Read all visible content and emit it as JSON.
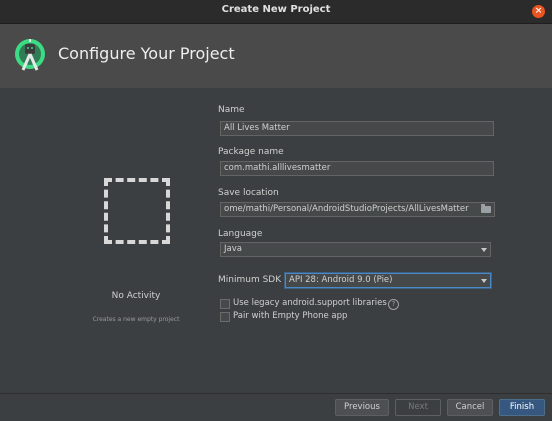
{
  "window": {
    "title": "Create New Project"
  },
  "header": {
    "heading": "Configure Your Project",
    "logo_icon": "android-studio-logo-icon"
  },
  "activity": {
    "name": "No Activity",
    "description": "Creates a new empty project"
  },
  "form": {
    "name": {
      "label": "Name",
      "value": "All Lives Matter"
    },
    "package": {
      "label": "Package name",
      "value": "com.mathi.alllivesmatter"
    },
    "save_location": {
      "label": "Save location",
      "value": "ome/mathi/Personal/AndroidStudioProjects/AllLivesMatter"
    },
    "language": {
      "label": "Language",
      "value": "Java"
    },
    "min_sdk": {
      "label": "Minimum SDK",
      "value": "API 28: Android 9.0 (Pie)"
    },
    "legacy_support": {
      "label": "Use legacy android.support libraries",
      "checked": false
    },
    "phone_app": {
      "label": "Pair with Empty Phone app",
      "checked": false
    }
  },
  "buttons": {
    "previous": "Previous",
    "next": "Next",
    "cancel": "Cancel",
    "finish": "Finish"
  },
  "colors": {
    "accent": "#365880",
    "close": "#e95420",
    "background": "#3c3f41"
  }
}
